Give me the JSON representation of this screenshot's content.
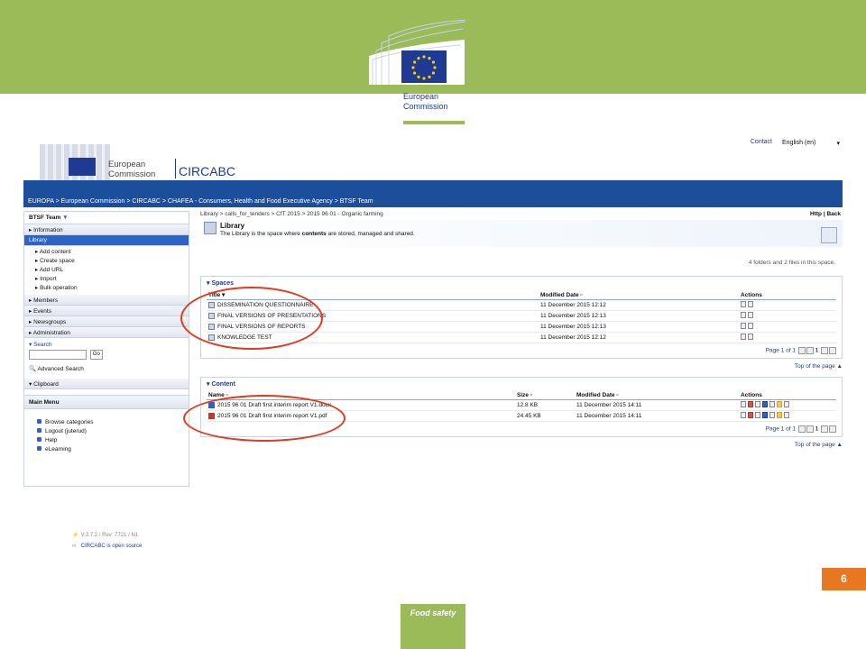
{
  "ec_logo": {
    "line1": "European",
    "line2": "Commission"
  },
  "screenshot": {
    "top_links": {
      "contact": "Contact",
      "language": "English (en)"
    },
    "header": {
      "ec_line1": "European",
      "ec_line2": "Commission",
      "app_name": "CIRCABC"
    },
    "breadcrumb": "EUROPA > European Commission > CIRCABC > CHAFEA - Consumers, Health and Food Executive Agency > BTSF Team",
    "left": {
      "title": "BTSF Team",
      "sections": {
        "information": "Information",
        "library": "Library",
        "members": "Members",
        "events": "Events",
        "newsgroups": "Newsgroups",
        "administration": "Administration",
        "search": "Search",
        "clipboard": "Clipboard"
      },
      "library_actions": [
        "Add content",
        "Create space",
        "Add URL",
        "Import",
        "Bulk operation"
      ],
      "search_go": "Go",
      "advanced_search": "Advanced Search",
      "main_menu": {
        "title": "Main Menu",
        "items": [
          "Browse categories",
          "Logout (juterud)",
          "Help",
          "eLearning"
        ]
      }
    },
    "right": {
      "path": "Library > calls_for_tenders > CfT 2015 > 2015 96 01 - Organic farming",
      "help": "Http | Back",
      "library_title": "Library",
      "library_desc_prefix": "The Library is the space where",
      "library_desc_bold": "contents",
      "library_desc_suffix": "are stored, managed and shared.",
      "count": "4 folders and 2 files in this space.",
      "spaces": {
        "title": "Spaces",
        "headers": {
          "title": "Title",
          "modified": "Modified Date",
          "actions": "Actions"
        },
        "rows": [
          {
            "title": "DISSEMINATION QUESTIONNAIRE",
            "modified": "11 December 2015 12:12"
          },
          {
            "title": "FINAL VERSIONS OF PRESENTATIONS",
            "modified": "11 December 2015 12:13"
          },
          {
            "title": "FINAL VERSIONS OF REPORTS",
            "modified": "11 December 2015 12:13"
          },
          {
            "title": "KNOWLEDGE TEST",
            "modified": "11 December 2015 12:12"
          }
        ],
        "pager": "Page 1 of 1",
        "current_page": "1"
      },
      "top_of_page": "Top of the page",
      "content": {
        "title": "Content",
        "headers": {
          "name": "Name",
          "size": "Size",
          "modified": "Modified Date",
          "actions": "Actions"
        },
        "rows": [
          {
            "name": "2015 96 01 Draft first interim report V1.docx",
            "size": "12.8 KB",
            "modified": "11 December 2015 14:11",
            "type": "doc"
          },
          {
            "name": "2015 96 01 Draft first interim report V1.pdf",
            "size": "24.45 KB",
            "modified": "11 December 2015 14:11",
            "type": "pdf"
          }
        ],
        "pager": "Page 1 of 1"
      }
    },
    "footer": {
      "version": "V.3.7.2 / Rev: 7721 / N1",
      "open_source": "CIRCABC is open source"
    }
  },
  "page_number": "6",
  "footer_tag": "Food safety",
  "colors": {
    "green": "#9bbb59",
    "blue": "#1b4f9c",
    "orange": "#e87722",
    "highlight": "#e03a1f"
  }
}
